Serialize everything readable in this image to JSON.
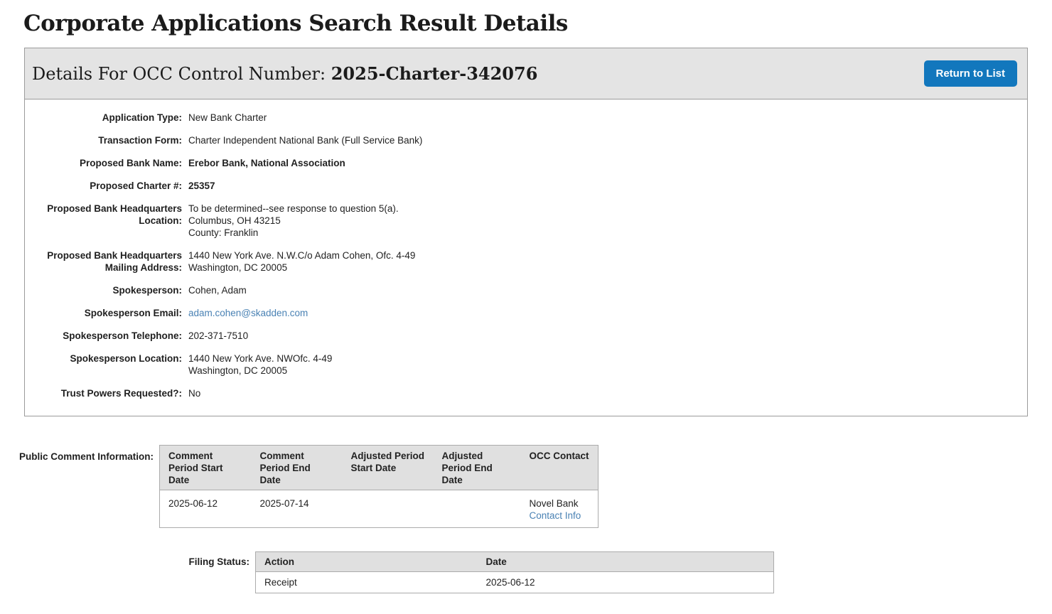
{
  "page": {
    "title": "Corporate Applications Search Result Details"
  },
  "panel": {
    "header_label": "Details For OCC Control Number: ",
    "control_number": "2025-Charter-342076",
    "return_button_label": "Return to List",
    "fields": [
      {
        "label": "Application Type:",
        "value": "New Bank Charter"
      },
      {
        "label": "Transaction Form:",
        "value": "Charter Independent National Bank (Full Service Bank)"
      },
      {
        "label": "Proposed Bank Name:",
        "value": "Erebor Bank, National Association"
      },
      {
        "label": "Proposed Charter #:",
        "value": "25357"
      },
      {
        "label": "Proposed Bank Headquarters Location:",
        "lines": [
          "To be determined--see response to question 5(a).",
          "Columbus, OH 43215",
          "County: Franklin"
        ]
      },
      {
        "label": "Proposed Bank Headquarters Mailing Address:",
        "lines": [
          "1440 New York Ave. N.W.C/o Adam Cohen, Ofc. 4-49",
          "Washington, DC 20005"
        ]
      },
      {
        "label": "Spokesperson:",
        "value": "Cohen, Adam"
      },
      {
        "label": "Spokesperson Email:",
        "value": "adam.cohen@skadden.com"
      },
      {
        "label": "Spokesperson Telephone:",
        "value": "202-371-7510"
      },
      {
        "label": "Spokesperson Location:",
        "lines": [
          "1440 New York Ave. NWOfc. 4-49",
          "Washington, DC 20005"
        ]
      },
      {
        "label": "Trust Powers Requested?:",
        "value": "No"
      }
    ]
  },
  "public_comment": {
    "section_label": "Public Comment Information:",
    "headers": [
      "Comment Period Start Date",
      "Comment Period End Date",
      "Adjusted Period Start Date",
      "Adjusted Period End Date",
      "OCC Contact"
    ],
    "row": {
      "comment_start": "2025-06-12",
      "comment_end": "2025-07-14",
      "adjusted_start": "",
      "adjusted_end": "",
      "contact_name": "Novel Bank",
      "contact_link": "Contact Info"
    }
  },
  "filing_status": {
    "section_label": "Filing Status:",
    "headers": [
      "Action",
      "Date"
    ],
    "rows": [
      {
        "action": "Receipt",
        "date": "2025-06-12"
      }
    ]
  },
  "colors": {
    "accent_blue": "#1277bd",
    "link_blue": "#4a82b4",
    "header_gray": "#e4e4e4",
    "table_header_gray": "#e0e0e0"
  }
}
